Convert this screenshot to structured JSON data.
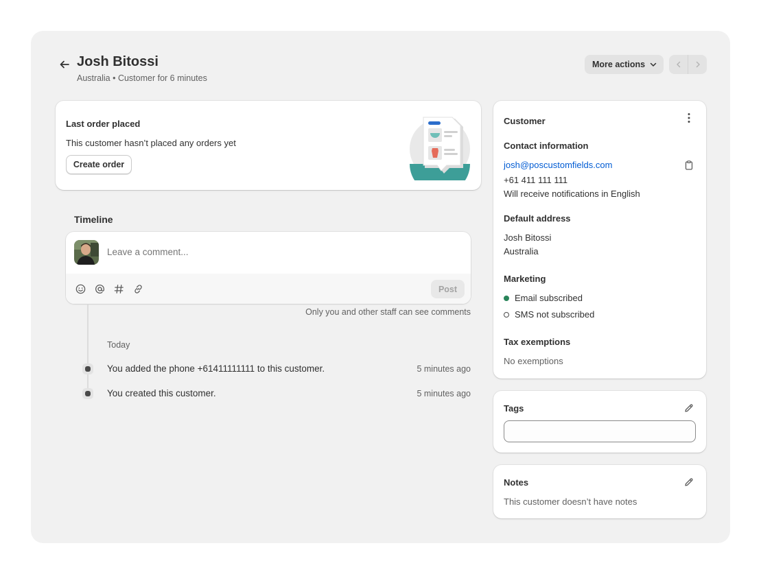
{
  "header": {
    "title": "Josh Bitossi",
    "subtitle": "Australia • Customer for 6 minutes",
    "more_actions_label": "More actions"
  },
  "last_order": {
    "heading": "Last order placed",
    "message": "This customer hasn’t placed any orders yet",
    "create_order_label": "Create order"
  },
  "timeline": {
    "title": "Timeline",
    "comment_placeholder": "Leave a comment...",
    "post_label": "Post",
    "visibility_note": "Only you and other staff can see comments",
    "group_label": "Today",
    "events": [
      {
        "text": "You added the phone +61411111111 to this customer.",
        "time": "5 minutes ago"
      },
      {
        "text": "You created this customer.",
        "time": "5 minutes ago"
      }
    ]
  },
  "customer": {
    "heading": "Customer",
    "contact_heading": "Contact information",
    "email": "josh@poscustomfields.com",
    "phone": "+61 411 111 111",
    "notification_language": "Will receive notifications in English",
    "address_heading": "Default address",
    "address_name": "Josh Bitossi",
    "address_country": "Australia",
    "marketing_heading": "Marketing",
    "email_marketing": "Email subscribed",
    "sms_marketing": "SMS not subscribed",
    "tax_heading": "Tax exemptions",
    "tax_value": "No exemptions"
  },
  "tags": {
    "heading": "Tags",
    "input_value": ""
  },
  "notes": {
    "heading": "Notes",
    "text": "This customer doesn’t have notes"
  },
  "colors": {
    "link": "#005bd3",
    "subscribed": "#29845a",
    "illustration_teal": "#3d9e98",
    "illustration_blue": "#2c6ecb"
  }
}
